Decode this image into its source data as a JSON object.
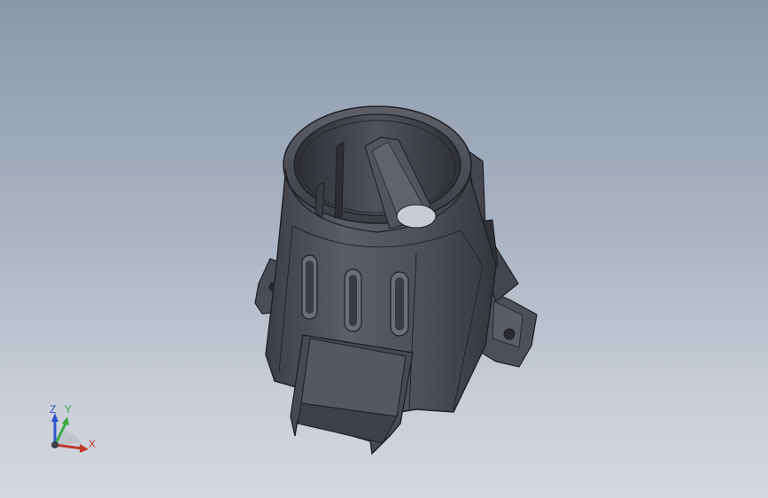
{
  "viewport": {
    "background_top": "#8c98aa",
    "background_bottom": "#d4d8de"
  },
  "model": {
    "body_color": "#4a4d55",
    "edge_color": "#1e2026"
  },
  "triad": {
    "x_label": "X",
    "y_label": "Y",
    "z_label": "Z",
    "x_color": "#c0392b",
    "y_color": "#3aa845",
    "z_color": "#2d55c8"
  }
}
